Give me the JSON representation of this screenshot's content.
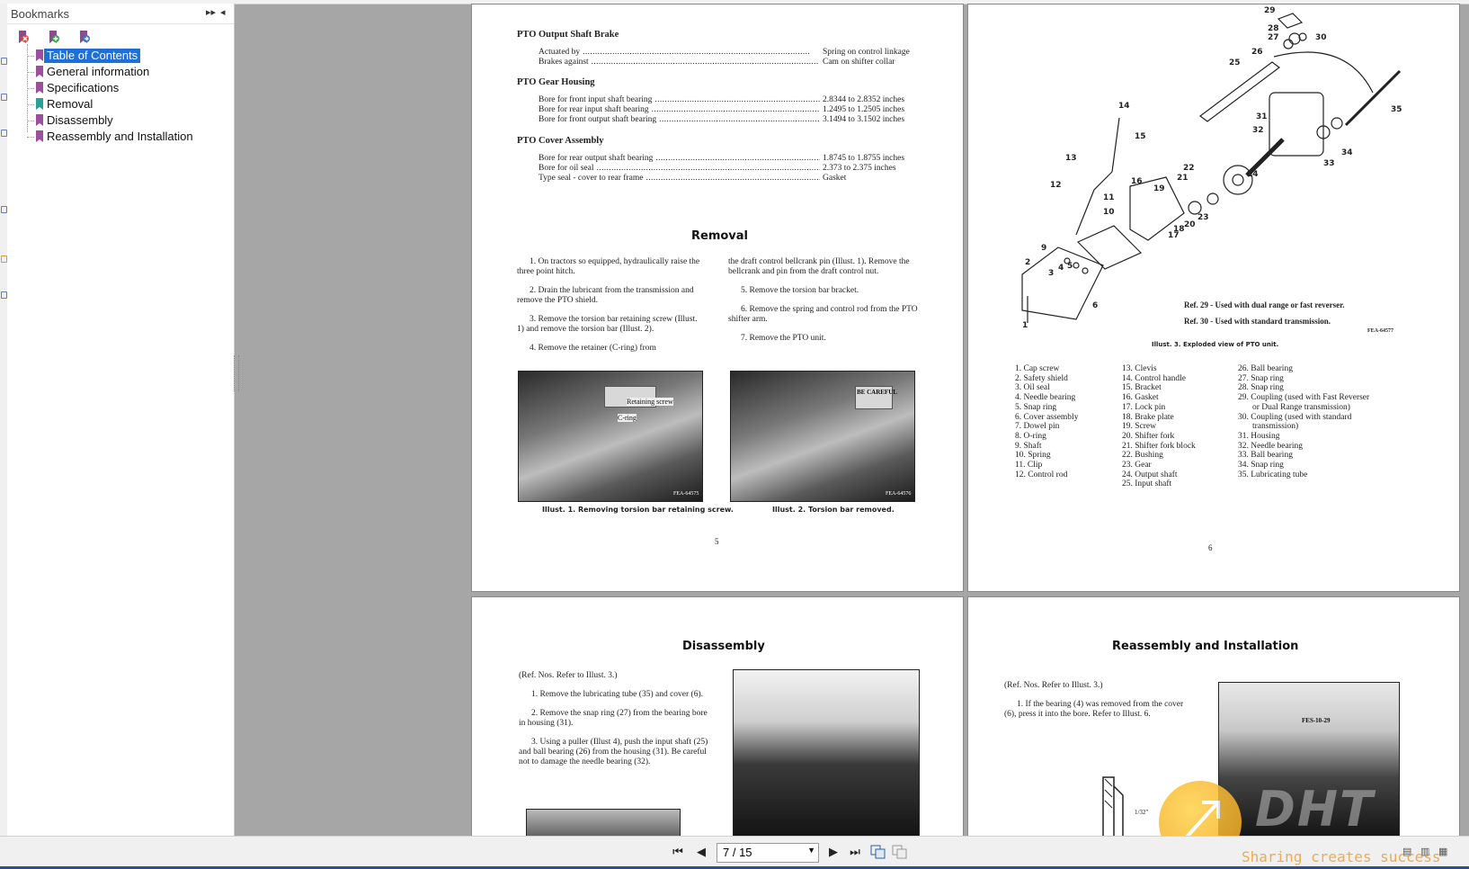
{
  "sidebar": {
    "title": "Bookmarks",
    "controls": {
      "expand": "▸▸",
      "collapse": "◂"
    },
    "items": [
      {
        "label": "Table of Contents",
        "selected": true
      },
      {
        "label": "General information"
      },
      {
        "label": "Specifications"
      },
      {
        "label": "Removal"
      },
      {
        "label": "Disassembly"
      },
      {
        "label": "Reassembly and Installation"
      }
    ]
  },
  "page5": {
    "pto_brake": {
      "heading": "PTO Output Shaft Brake",
      "rows": [
        {
          "k": "Actuated by",
          "v": "Spring on control linkage"
        },
        {
          "k": "Brakes against",
          "v": "Cam on shifter collar"
        }
      ]
    },
    "gear_housing": {
      "heading": "PTO Gear Housing",
      "rows": [
        {
          "k": "Bore for front input shaft bearing",
          "v": "2.8344 to 2.8352 inches"
        },
        {
          "k": "Bore for rear input shaft bearing",
          "v": "1.2495 to 1.2505 inches"
        },
        {
          "k": "Bore for front output shaft bearing",
          "v": "3.1494 to 3.1502 inches"
        }
      ]
    },
    "cover_assembly": {
      "heading": "PTO Cover Assembly",
      "rows": [
        {
          "k": "Bore for rear output shaft bearing",
          "v": "1.8745 to 1.8755 inches"
        },
        {
          "k": "Bore for oil seal",
          "v": "2.373 to 2.375 inches"
        },
        {
          "k": "Type seal - cover to rear frame",
          "v": "Gasket"
        }
      ]
    },
    "removal_title": "Removal",
    "removal_left": [
      "1. On tractors so equipped, hydraulically raise the three point hitch.",
      "2. Drain the lubricant from the transmission and remove the PTO shield.",
      "3. Remove the torsion bar retaining screw (Illust. 1) and remove the torsion bar (Illust. 2).",
      "4. Remove the retainer (C-ring) from"
    ],
    "removal_right": [
      "the draft control bellcrank pin (Illust. 1). Remove the bellcrank and pin from the draft control nut.",
      "5. Remove the torsion bar bracket.",
      "6. Remove the spring and control rod from the PTO shifter arm.",
      "7. Remove the PTO unit."
    ],
    "photo1_labels": [
      "Retaining screw",
      "C-ring",
      "FEA-64575"
    ],
    "photo2_labels": [
      "BE CAREFUL",
      "FEA-64576"
    ],
    "caption1": "Illust. 1. Removing torsion bar retaining screw.",
    "caption2": "Illust. 2. Torsion bar removed.",
    "page_number": "5"
  },
  "page6": {
    "callouts": [
      "29",
      "28",
      "27",
      "30",
      "26",
      "25",
      "35",
      "31",
      "32",
      "34",
      "33",
      "24",
      "14",
      "15",
      "13",
      "22",
      "12",
      "11",
      "10",
      "16",
      "19",
      "21",
      "23",
      "20",
      "18",
      "17",
      "9",
      "2",
      "3",
      "4",
      "5",
      "6",
      "1"
    ],
    "note1": "Ref. 29 - Used with dual range or fast reverser.",
    "note2": "Ref. 30 - Used with standard transmission.",
    "fig_code": "FEA-64577",
    "caption": "Illust. 3. Exploded view of PTO unit.",
    "parts_col1": [
      "1. Cap screw",
      "2. Safety shield",
      "3. Oil seal",
      "4. Needle bearing",
      "5. Snap ring",
      "6. Cover assembly",
      "7. Dowel pin",
      "8. O-ring",
      "9. Shaft",
      "10. Spring",
      "11. Clip",
      "12. Control rod"
    ],
    "parts_col2": [
      "13. Clevis",
      "14. Control handle",
      "15. Bracket",
      "16. Gasket",
      "17. Lock pin",
      "18. Brake plate",
      "19. Screw",
      "20. Shifter fork",
      "21. Shifter fork block",
      "22. Bushing",
      "23. Gear",
      "24. Output shaft",
      "25. Input shaft"
    ],
    "parts_col3": [
      "26. Ball bearing",
      "27. Snap ring",
      "28. Snap ring",
      "29. Coupling (used with Fast Reverser",
      "    or Dual Range transmission)",
      "30. Coupling (used with standard",
      "    transmission)",
      "31. Housing",
      "32. Needle bearing",
      "33. Ball bearing",
      "34. Snap ring",
      "35. Lubricating tube"
    ],
    "page_number": "6"
  },
  "page7": {
    "title": "Disassembly",
    "ref": "(Ref. Nos. Refer to Illust. 3.)",
    "steps": [
      "1. Remove the lubricating tube (35) and cover (6).",
      "2. Remove the snap ring (27) from the bearing bore in housing (31).",
      "3. Using a puller (Illust 4), push the input shaft (25) and ball bearing (26) from the housing (31). Be careful not to damage the needle bearing (32)."
    ]
  },
  "page8": {
    "title": "Reassembly and Installation",
    "ref": "(Ref. Nos. Refer to Illust. 3.)",
    "steps": [
      "1. If the bearing (4) was removed from the cover (6), press it into the bore. Refer to Illust. 6."
    ],
    "photo_label": "FES-10-29",
    "dim_label": "1/32\""
  },
  "toolbar": {
    "page_indicator": "7 / 15",
    "first": "⏮",
    "prev": "◀",
    "next": "▶",
    "last": "⏭"
  },
  "watermark": {
    "logo": "DHT",
    "tagline": "Sharing creates success"
  }
}
